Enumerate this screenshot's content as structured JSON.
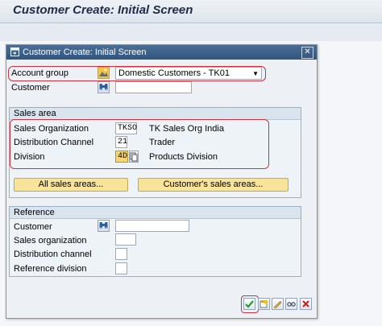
{
  "app": {
    "title": "Customer Create: Initial Screen"
  },
  "dialog": {
    "title": "Customer Create: Initial Screen",
    "close_glyph": "✕"
  },
  "fields": {
    "account_group": {
      "label": "Account group",
      "value": "Domestic Customers - TK01"
    },
    "customer": {
      "label": "Customer",
      "value": ""
    }
  },
  "sales_area": {
    "title": "Sales area",
    "sales_org": {
      "label": "Sales Organization",
      "value": "TKSO",
      "text": "TK Sales Org India"
    },
    "dist_channel": {
      "label": "Distribution Channel",
      "value": "21",
      "text": "Trader"
    },
    "division": {
      "label": "Division",
      "value": "4D",
      "text": "Products Division"
    },
    "all_sales_areas_button": "All sales areas...",
    "customer_sales_areas_button": "Customer's sales areas..."
  },
  "reference": {
    "title": "Reference",
    "customer": {
      "label": "Customer",
      "value": ""
    },
    "sales_org": {
      "label": "Sales organization",
      "value": ""
    },
    "dist_channel": {
      "label": "Distribution channel",
      "value": ""
    },
    "ref_division": {
      "label": "Reference division",
      "value": ""
    }
  },
  "toolbar": {
    "icons": [
      "checkmark-icon",
      "new-entries-icon",
      "edit-icon",
      "glasses-icon",
      "cancel-icon"
    ]
  },
  "colors": {
    "highlight": "#d0323c",
    "button_yellow": "#f8e39a",
    "title_bar": "#2f5580"
  }
}
